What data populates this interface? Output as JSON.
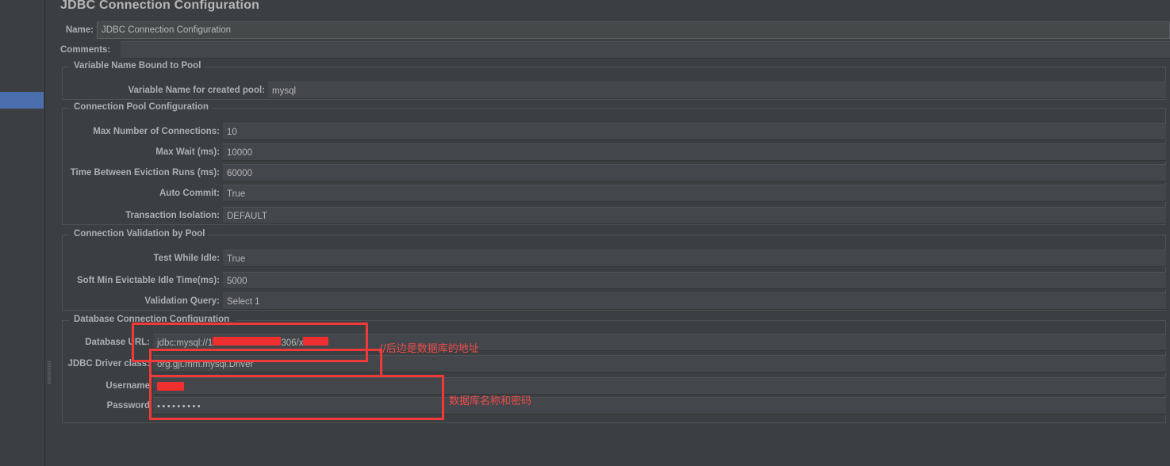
{
  "window": {
    "title": "JDBC Connection Configuration"
  },
  "sidebar": {
    "selected_item_label": ""
  },
  "header": {
    "name_label": "Name:",
    "name_value": "JDBC Connection Configuration",
    "comments_label": "Comments:",
    "comments_value": ""
  },
  "groups": {
    "variable_pool": {
      "title": "Variable Name Bound to Pool",
      "rows": [
        {
          "label": "Variable Name for created pool:",
          "value": "mysql"
        }
      ]
    },
    "pool_config": {
      "title": "Connection Pool Configuration",
      "rows": [
        {
          "label": "Max Number of Connections:",
          "value": "10"
        },
        {
          "label": "Max Wait (ms):",
          "value": "10000"
        },
        {
          "label": "Time Between Eviction Runs (ms):",
          "value": "60000"
        },
        {
          "label": "Auto Commit:",
          "value": "True"
        },
        {
          "label": "Transaction Isolation:",
          "value": "DEFAULT"
        }
      ]
    },
    "validation": {
      "title": "Connection Validation by Pool",
      "rows": [
        {
          "label": "Test While Idle:",
          "value": "True"
        },
        {
          "label": "Soft Min Evictable Idle Time(ms):",
          "value": "5000"
        },
        {
          "label": "Validation Query:",
          "value": "Select 1"
        }
      ]
    },
    "database": {
      "title": "Database Connection Configuration",
      "url_label": "Database URL:",
      "url_prefix": "jdbc:mysql://1",
      "url_redacted_host": "",
      "url_port_path": "306/x",
      "url_redacted_db": "",
      "driver_label": "JDBC Driver class:",
      "driver_value": "org.gjt.mm.mysql.Driver",
      "username_label": "Username",
      "username_redacted": "",
      "password_label": "Password",
      "password_value": "•••••••••"
    }
  },
  "annotations": [
    {
      "name": "url-note",
      "text": "//后边是数据库的地址"
    },
    {
      "name": "credentials-note",
      "text": "数据库名称和密码"
    }
  ],
  "colors": {
    "panel_bg": "#3c3f41",
    "field_bg": "#45494a",
    "selection_blue": "#4b6eaf",
    "annotation_red": "#f03a3a",
    "text": "#a9b0b5"
  }
}
